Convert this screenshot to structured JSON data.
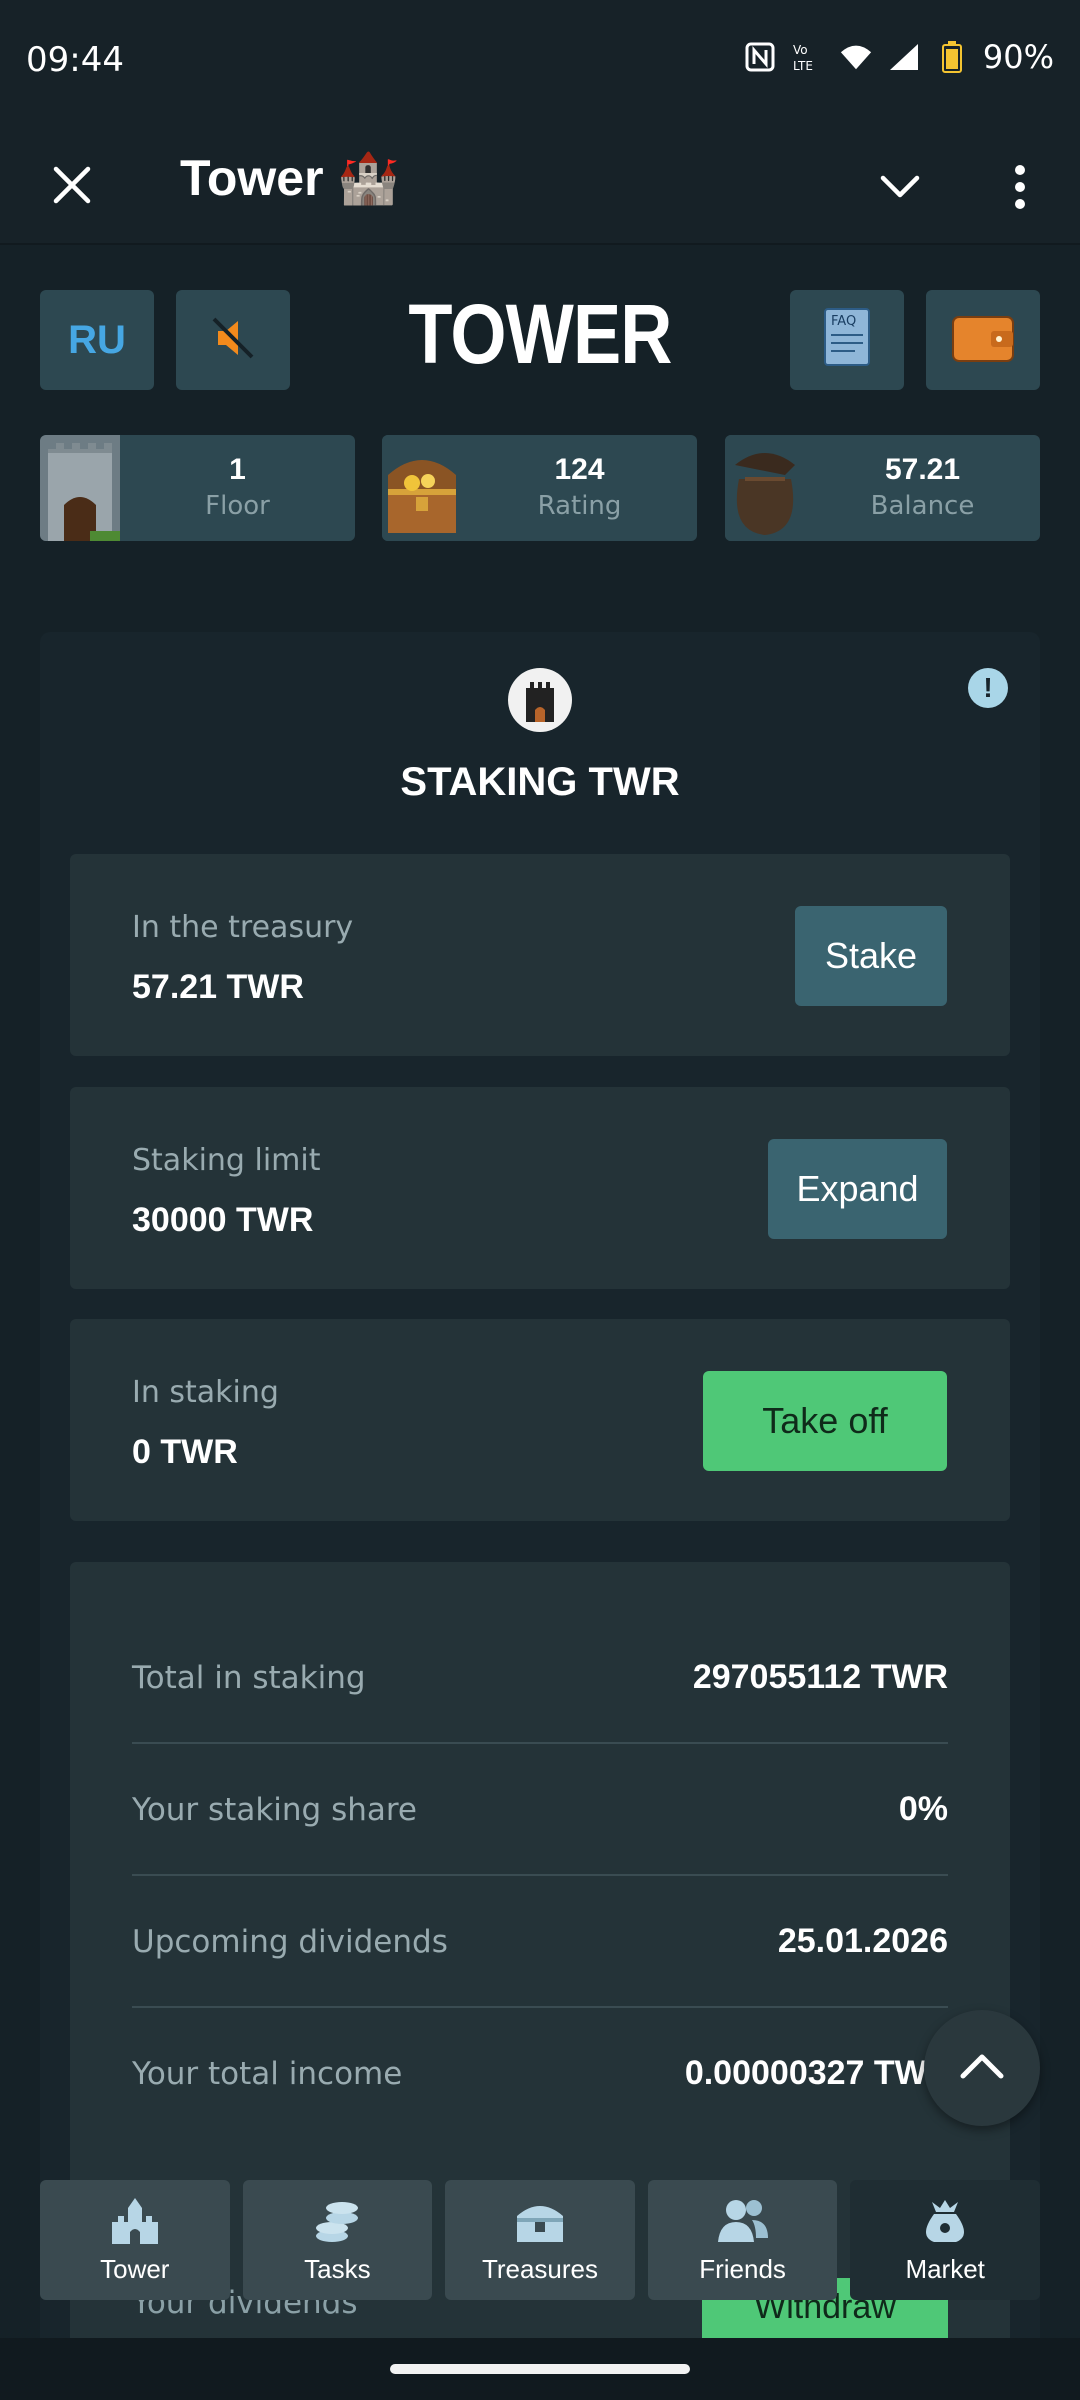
{
  "status": {
    "time": "09:44",
    "battery": "90%",
    "icons": [
      "nfc-icon",
      "volte-icon",
      "wifi-icon",
      "signal-icon",
      "battery-icon"
    ]
  },
  "appbar": {
    "title": "Tower 🏰"
  },
  "header": {
    "lang": "RU",
    "logo": "TOWER",
    "faq_icon_text": "FAQ"
  },
  "stats": [
    {
      "value": "1",
      "label": "Floor"
    },
    {
      "value": "124",
      "label": "Rating"
    },
    {
      "value": "57.21",
      "label": "Balance"
    }
  ],
  "staking": {
    "title": "STAKING TWR",
    "info_icon": "!",
    "cards": [
      {
        "label": "In the treasury",
        "value": "57.21 TWR",
        "button": "Stake"
      },
      {
        "label": "Staking limit",
        "value": "30000 TWR",
        "button": "Expand"
      },
      {
        "label": "In staking",
        "value": "0 TWR",
        "button": "Take off"
      }
    ],
    "rows": [
      {
        "label": "Total in staking",
        "value": "297055112 TWR"
      },
      {
        "label": "Your staking share",
        "value": "0%"
      },
      {
        "label": "Upcoming dividends",
        "value": "25.01.2026"
      },
      {
        "label": "Your total income",
        "value": "0.00000327 TWRINV"
      }
    ],
    "dividends_label": "Your dividends",
    "withdraw": "Withdraw"
  },
  "nav": [
    {
      "label": "Tower",
      "icon": "castle-icon"
    },
    {
      "label": "Tasks",
      "icon": "coins-icon"
    },
    {
      "label": "Treasures",
      "icon": "chest-icon"
    },
    {
      "label": "Friends",
      "icon": "people-icon"
    },
    {
      "label": "Market",
      "icon": "bag-icon"
    }
  ],
  "colors": {
    "background": "#152127",
    "card": "#243338",
    "accent_green": "#4fc877",
    "button_blue": "#3a6470",
    "lang_blue": "#46a7e3"
  }
}
